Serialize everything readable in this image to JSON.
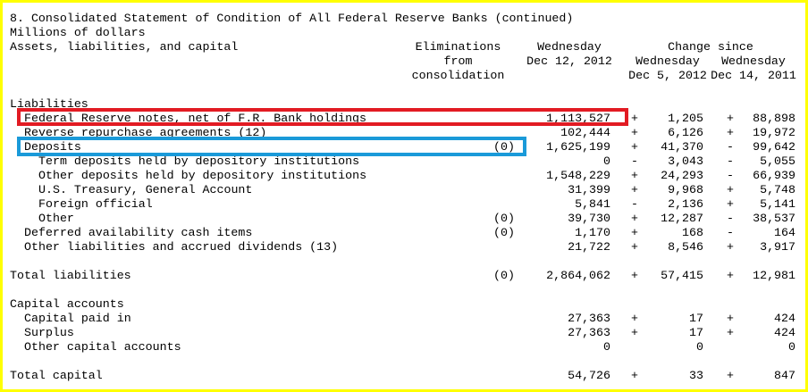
{
  "table_title": "8. Consolidated Statement of Condition of All Federal Reserve Banks (continued)",
  "units": "Millions of dollars",
  "headers": {
    "col1": "Assets, liabilities, and capital",
    "elim": [
      "Eliminations",
      "from",
      "consolidation"
    ],
    "wed": [
      "Wednesday",
      "Dec 12, 2012"
    ],
    "change_since": "Change since",
    "chg1": [
      "Wednesday",
      "Dec 5, 2012"
    ],
    "chg2": [
      "Wednesday",
      "Dec 14, 2011"
    ]
  },
  "sections": {
    "liabilities": "Liabilities",
    "capital": "Capital accounts"
  },
  "rows": [
    {
      "label": "Federal Reserve notes, net of F.R. Bank holdings",
      "elim": "",
      "value": "1,113,527",
      "s1": "+",
      "c1": "1,205",
      "s2": "+",
      "c2": "88,898"
    },
    {
      "label": "Reverse repurchase agreements (12)",
      "elim": "",
      "value": "102,444",
      "s1": "+",
      "c1": "6,126",
      "s2": "+",
      "c2": "19,972"
    },
    {
      "label": "Deposits",
      "elim": "(0)",
      "value": "1,625,199",
      "s1": "+",
      "c1": "41,370",
      "s2": "-",
      "c2": "99,642"
    },
    {
      "label": "Term deposits held by depository institutions",
      "elim": "",
      "value": "0",
      "s1": "-",
      "c1": "3,043",
      "s2": "-",
      "c2": "5,055"
    },
    {
      "label": "Other deposits held by depository institutions",
      "elim": "",
      "value": "1,548,229",
      "s1": "+",
      "c1": "24,293",
      "s2": "-",
      "c2": "66,939"
    },
    {
      "label": "U.S. Treasury, General Account",
      "elim": "",
      "value": "31,399",
      "s1": "+",
      "c1": "9,968",
      "s2": "+",
      "c2": "5,748"
    },
    {
      "label": "Foreign official",
      "elim": "",
      "value": "5,841",
      "s1": "-",
      "c1": "2,136",
      "s2": "+",
      "c2": "5,141"
    },
    {
      "label": "Other",
      "elim": "(0)",
      "value": "39,730",
      "s1": "+",
      "c1": "12,287",
      "s2": "-",
      "c2": "38,537"
    },
    {
      "label": "Deferred availability cash items",
      "elim": "(0)",
      "value": "1,170",
      "s1": "+",
      "c1": "168",
      "s2": "-",
      "c2": "164"
    },
    {
      "label": "Other liabilities and accrued dividends (13)",
      "elim": "",
      "value": "21,722",
      "s1": "+",
      "c1": "8,546",
      "s2": "+",
      "c2": "3,917"
    },
    {
      "label": "Total liabilities",
      "elim": "(0)",
      "value": "2,864,062",
      "s1": "+",
      "c1": "57,415",
      "s2": "+",
      "c2": "12,981"
    },
    {
      "label": "Capital paid in",
      "elim": "",
      "value": "27,363",
      "s1": "+",
      "c1": "17",
      "s2": "+",
      "c2": "424"
    },
    {
      "label": "Surplus",
      "elim": "",
      "value": "27,363",
      "s1": "+",
      "c1": "17",
      "s2": "+",
      "c2": "424"
    },
    {
      "label": "Other capital accounts",
      "elim": "",
      "value": "0",
      "s1": "",
      "c1": "0",
      "s2": "",
      "c2": "0"
    },
    {
      "label": "Total capital",
      "elim": "",
      "value": "54,726",
      "s1": "+",
      "c1": "33",
      "s2": "+",
      "c2": "847"
    }
  ],
  "highlight_colors": {
    "frame": "#ffff00",
    "red": "#e21b23",
    "blue": "#1a9ad9"
  }
}
